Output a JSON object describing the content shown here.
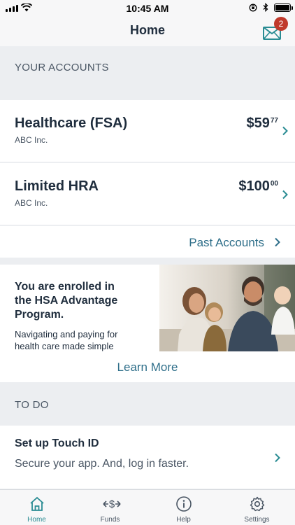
{
  "status_bar": {
    "time": "10:45 AM"
  },
  "header": {
    "title": "Home",
    "badge_count": "2",
    "mail_icon": "mail-icon"
  },
  "accounts_section": {
    "label": "YOUR ACCOUNTS"
  },
  "accounts": [
    {
      "name": "Healthcare (FSA)",
      "employer": "ABC Inc.",
      "amount_main": "$59",
      "amount_cents": "77"
    },
    {
      "name": "Limited HRA",
      "employer": "ABC Inc.",
      "amount_main": "$100",
      "amount_cents": "00"
    }
  ],
  "past_accounts": {
    "label": "Past Accounts"
  },
  "promo": {
    "title": "You are enrolled in the HSA Advantage Program.",
    "body": "Navigating and paying for health care made simple",
    "link": "Learn More"
  },
  "todo_section": {
    "label": "TO DO"
  },
  "todo": {
    "title": "Set up Touch ID",
    "subtitle": "Secure your app. And, log in faster."
  },
  "tabs": [
    {
      "label": "Home",
      "icon": "home-icon",
      "active": true
    },
    {
      "label": "Funds",
      "icon": "funds-icon",
      "active": false
    },
    {
      "label": "Help",
      "icon": "help-icon",
      "active": false
    },
    {
      "label": "Settings",
      "icon": "settings-icon",
      "active": false
    }
  ],
  "colors": {
    "accent": "#2a8c93",
    "link": "#2f6f8a",
    "badge": "#c0392b",
    "text": "#1f2d3d",
    "background": "#eceef1"
  }
}
